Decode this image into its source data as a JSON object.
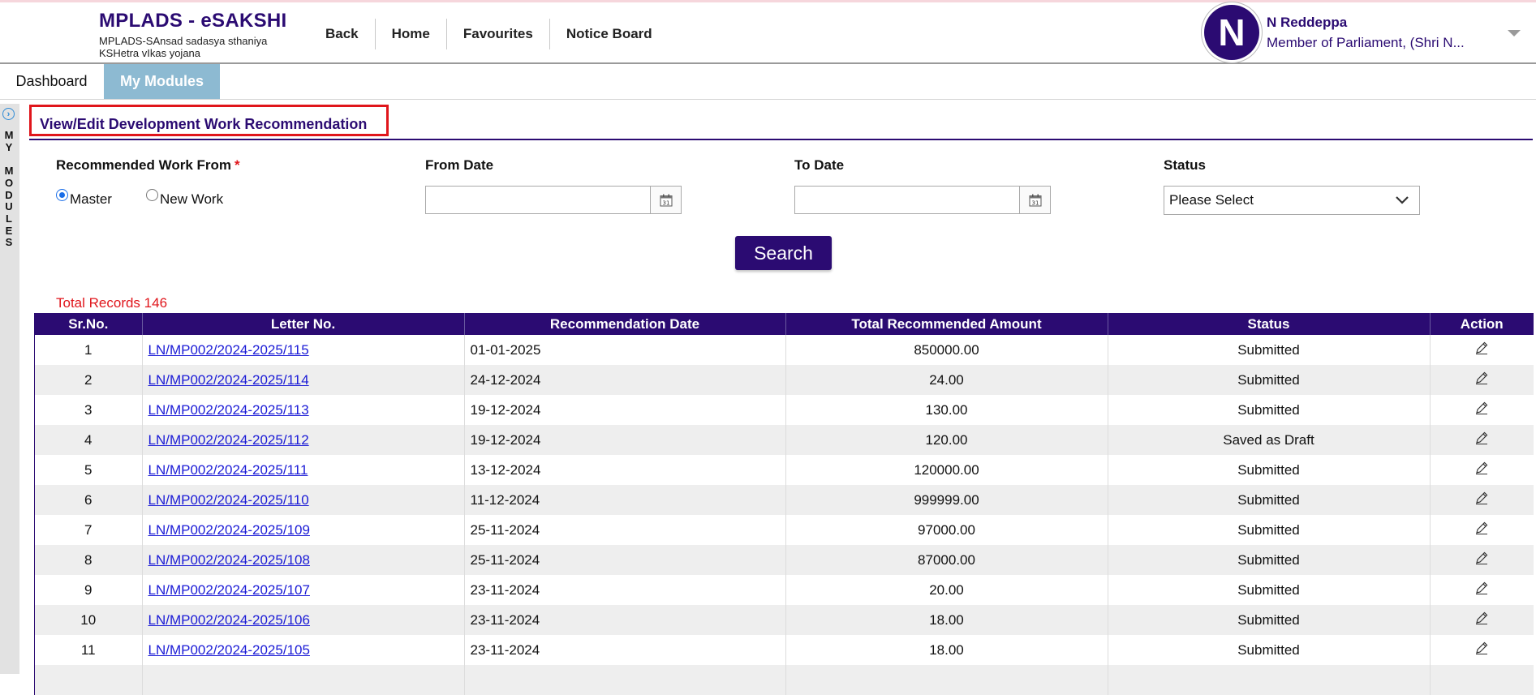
{
  "header": {
    "app_title": "MPLADS - eSAKSHI",
    "app_subtitle": "MPLADS-SAnsad sadasya sthaniya KSHetra vIkas yojana",
    "nav": [
      "Back",
      "Home",
      "Favourites",
      "Notice Board"
    ],
    "user": {
      "avatar_letter": "N",
      "name": "N Reddeppa",
      "role": "Member of Parliament, (Shri N..."
    }
  },
  "tabs": {
    "dashboard": "Dashboard",
    "my_modules": "My Modules"
  },
  "sidebar": {
    "letters": [
      "M",
      "Y",
      "",
      "M",
      "O",
      "D",
      "U",
      "L",
      "E",
      "S"
    ],
    "toggle_icon": "chevron-right-circle-icon"
  },
  "page": {
    "title": "View/Edit Development Work Recommendation"
  },
  "filters": {
    "recommended_from_label": "Recommended Work From",
    "required_marker": "*",
    "option_master": "Master",
    "option_new_work": "New Work",
    "selected_option": "Master",
    "from_date_label": "From Date",
    "from_date_value": "",
    "to_date_label": "To Date",
    "to_date_value": "",
    "status_label": "Status",
    "status_value": "Please Select",
    "search_label": "Search"
  },
  "results": {
    "total_records": "Total Records 146",
    "columns": [
      "Sr.No.",
      "Letter No.",
      "Recommendation Date",
      "Total Recommended Amount",
      "Status",
      "Action"
    ],
    "rows": [
      {
        "sr": "1",
        "letter": "LN/MP002/2024-2025/115",
        "date": "01-01-2025",
        "amount": "850000.00",
        "status": "Submitted"
      },
      {
        "sr": "2",
        "letter": "LN/MP002/2024-2025/114",
        "date": "24-12-2024",
        "amount": "24.00",
        "status": "Submitted"
      },
      {
        "sr": "3",
        "letter": "LN/MP002/2024-2025/113",
        "date": "19-12-2024",
        "amount": "130.00",
        "status": "Submitted"
      },
      {
        "sr": "4",
        "letter": "LN/MP002/2024-2025/112",
        "date": "19-12-2024",
        "amount": "120.00",
        "status": "Saved as Draft"
      },
      {
        "sr": "5",
        "letter": "LN/MP002/2024-2025/111",
        "date": "13-12-2024",
        "amount": "120000.00",
        "status": "Submitted"
      },
      {
        "sr": "6",
        "letter": "LN/MP002/2024-2025/110",
        "date": "11-12-2024",
        "amount": "999999.00",
        "status": "Submitted"
      },
      {
        "sr": "7",
        "letter": "LN/MP002/2024-2025/109",
        "date": "25-11-2024",
        "amount": "97000.00",
        "status": "Submitted"
      },
      {
        "sr": "8",
        "letter": "LN/MP002/2024-2025/108",
        "date": "25-11-2024",
        "amount": "87000.00",
        "status": "Submitted"
      },
      {
        "sr": "9",
        "letter": "LN/MP002/2024-2025/107",
        "date": "23-11-2024",
        "amount": "20.00",
        "status": "Submitted"
      },
      {
        "sr": "10",
        "letter": "LN/MP002/2024-2025/106",
        "date": "23-11-2024",
        "amount": "18.00",
        "status": "Submitted"
      },
      {
        "sr": "11",
        "letter": "LN/MP002/2024-2025/105",
        "date": "23-11-2024",
        "amount": "18.00",
        "status": "Submitted"
      }
    ]
  },
  "colors": {
    "brand": "#2b0b72",
    "tab_active": "#8dbad2",
    "highlight": "#e0151b",
    "link": "#1a1ad6"
  }
}
